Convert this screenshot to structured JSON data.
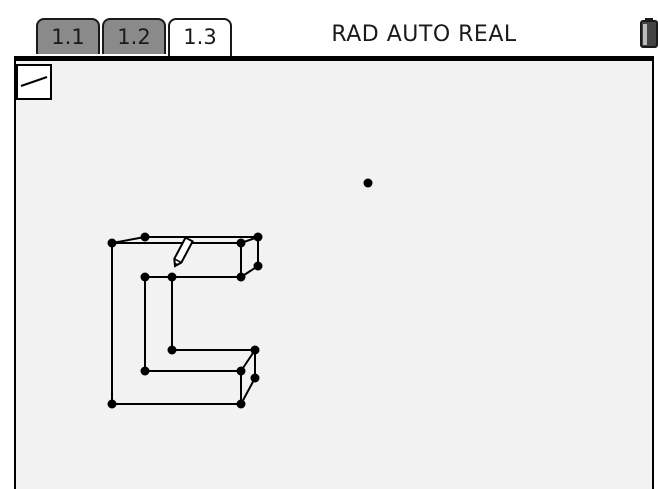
{
  "tabs": [
    {
      "label": "1.1"
    },
    {
      "label": "1.2"
    },
    {
      "label": "1.3"
    }
  ],
  "status": {
    "text": "RAD AUTO REAL"
  },
  "icons": {
    "tool": "segment-tool-icon",
    "battery": "battery-icon",
    "pencil": "pencil-cursor-icon"
  },
  "colors": {
    "ink": "#000000",
    "canvas": "#f2f2f2",
    "tab_inactive": "#8a8a8a",
    "tab_active": "#ffffff"
  }
}
